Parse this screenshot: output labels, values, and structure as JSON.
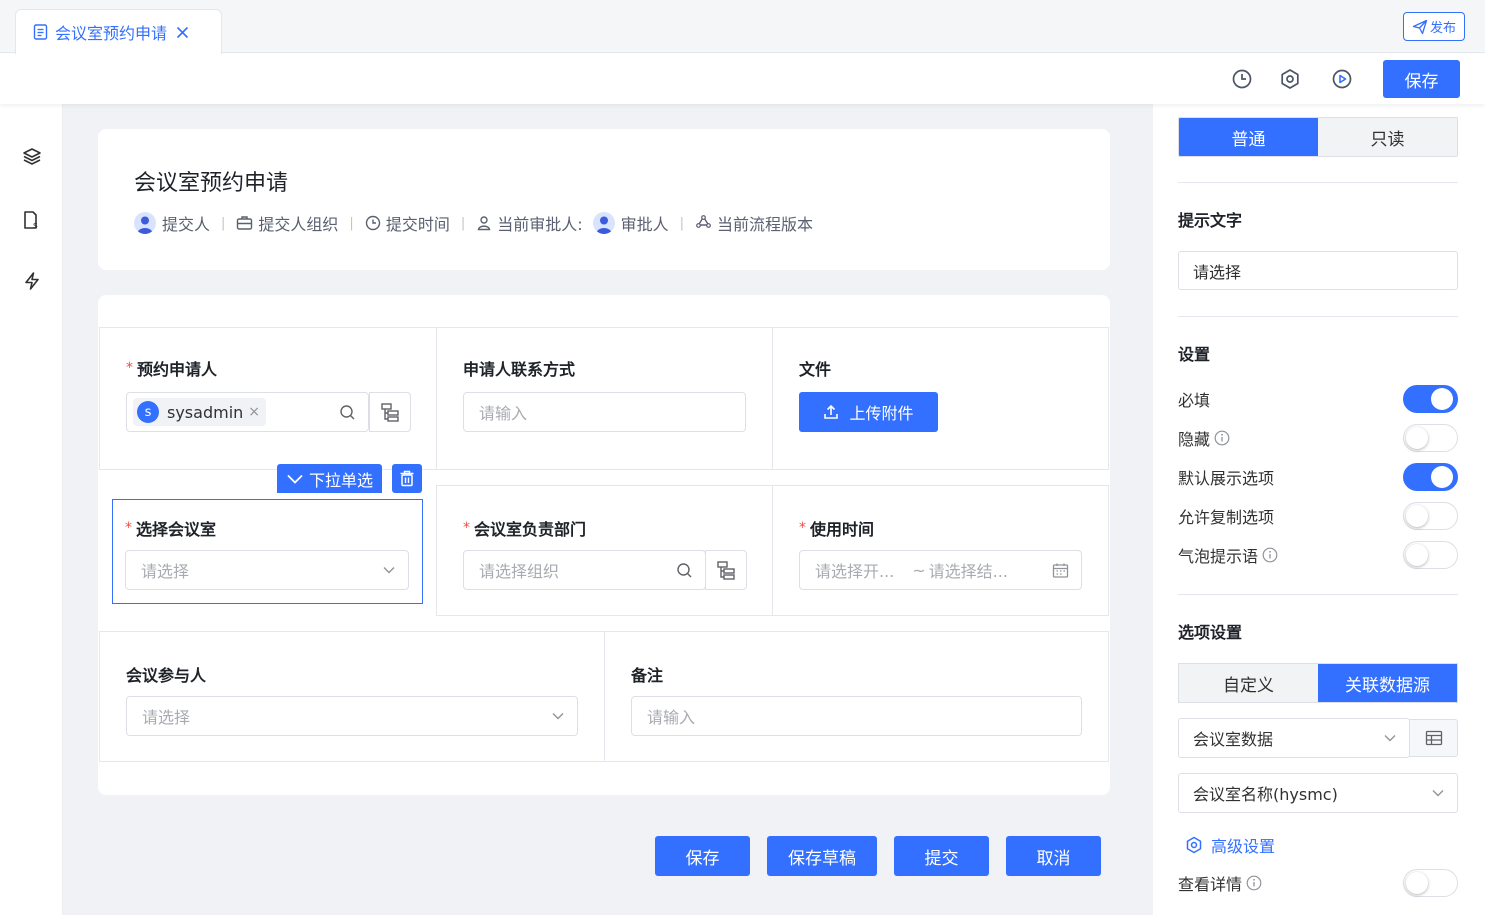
{
  "tab": {
    "title": "会议室预约申请"
  },
  "toolbar": {
    "publish": "发布",
    "save": "保存"
  },
  "header": {
    "title": "会议室预约申请",
    "submitter": "提交人",
    "submitter_org": "提交人组织",
    "submit_time": "提交时间",
    "current_approver_label": "当前审批人:",
    "approver": "审批人",
    "flow_version": "当前流程版本"
  },
  "form": {
    "applicant": {
      "label": "预约申请人",
      "chip_initial": "s",
      "chip_name": "sysadmin",
      "chip_close": "×"
    },
    "contact": {
      "label": "申请人联系方式",
      "placeholder": "请输入"
    },
    "file": {
      "label": "文件",
      "button": "上传附件"
    },
    "room": {
      "label": "选择会议室",
      "placeholder": "请选择"
    },
    "dept": {
      "label": "会议室负责部门",
      "placeholder": "请选择组织"
    },
    "time": {
      "label": "使用时间",
      "start_placeholder": "请选择开...",
      "sep": "~",
      "end_placeholder": "请选择结..."
    },
    "participants": {
      "label": "会议参与人",
      "placeholder": "请选择"
    },
    "remark": {
      "label": "备注",
      "placeholder": "请输入"
    },
    "selected_tag": "下拉单选",
    "required_mark": "*"
  },
  "actions": {
    "save": "保存",
    "draft": "保存草稿",
    "submit": "提交",
    "cancel": "取消"
  },
  "panel": {
    "mode_normal": "普通",
    "mode_readonly": "只读",
    "hint_title": "提示文字",
    "hint_value": "请选择",
    "settings_title": "设置",
    "settings": [
      {
        "label": "必填",
        "on": true,
        "info": false
      },
      {
        "label": "隐藏",
        "on": false,
        "info": true
      },
      {
        "label": "默认展示选项",
        "on": true,
        "info": false
      },
      {
        "label": "允许复制选项",
        "on": false,
        "info": false
      },
      {
        "label": "气泡提示语",
        "on": false,
        "info": true
      }
    ],
    "options_title": "选项设置",
    "src_custom": "自定义",
    "src_linked": "关联数据源",
    "datasource": "会议室数据",
    "field": "会议室名称(hysmc)",
    "advanced": "高级设置",
    "view_detail": "查看详情",
    "view_detail_on": false
  },
  "colors": {
    "accent": "#3370ff",
    "required": "#f54a45"
  }
}
